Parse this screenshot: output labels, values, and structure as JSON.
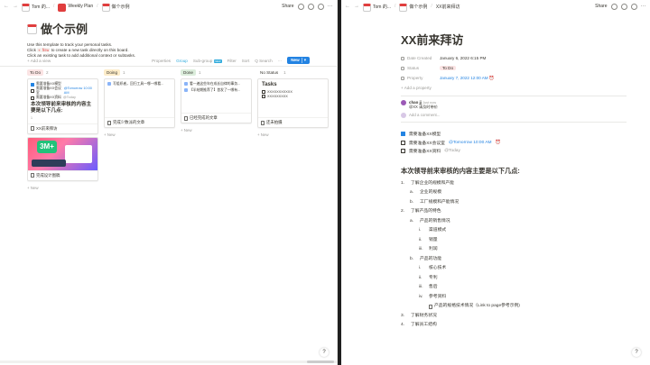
{
  "left": {
    "topbar": {
      "back": "←",
      "forward": "→",
      "crumbs": [
        "Tom 的...",
        "Weekly Plan",
        "做个示例"
      ],
      "share": "Share",
      "more": "···"
    },
    "page": {
      "title": "做个示例",
      "desc1": "Use this template to track your personal tasks.",
      "desc2_pre": "Click",
      "desc2_code": "+ New",
      "desc2_post": "to create a new task directly on this board.",
      "desc3": "Click an existing task to add additional context or subtasks."
    },
    "viewbar": {
      "add_view": "+ Add a view",
      "properties": "Properties",
      "group": "Group",
      "subgroup": "Sub-group",
      "subgroup_badge": "NEW",
      "filter": "Filter",
      "sort": "Sort",
      "search": "Q Search",
      "more": "···",
      "new": "New",
      "new_caret": "▾"
    },
    "columns": [
      {
        "label": "To Do",
        "count": "2"
      },
      {
        "label": "Doing",
        "count": "1"
      },
      {
        "label": "Done",
        "count": "1"
      },
      {
        "label": "No Status",
        "count": "1"
      }
    ],
    "todo_card1": {
      "chk1": "需要准备XX模型",
      "chk2a": "需要准备XX会议室 ",
      "chk2b": "@Tomorrow 10:00 AM",
      "chk3a": "需要准备XX资料 ",
      "chk3b": "@Today",
      "heading": "本次领导前来审核的内容主要是以下几点:",
      "tag": "1",
      "title": "XX前来拜访"
    },
    "todo_card2": {
      "title": "完成设计图稿"
    },
    "doing_card": {
      "cover": "写组织者，回归工具一哪一哪看...",
      "title": "完成少数派的文章"
    },
    "done_card": {
      "cover1": "看一遍这些年在成长自律的事务...",
      "cover2": "【半结期推荐了】首发了一哪有...",
      "title": "已经完成的文章"
    },
    "nostatus_card": {
      "heading": "Tasks",
      "item1": "XXXXXXXXXXX",
      "item2": "XXXXXXXXX",
      "title": "还未拍摄"
    },
    "new_label": "+ New",
    "help": "?"
  },
  "right": {
    "topbar": {
      "back": "←",
      "forward": "→",
      "crumbs": [
        "Tom 的...",
        "做个示例",
        "XX前来拜访"
      ],
      "share": "Share",
      "more": "···"
    },
    "title": "XX前来拜访",
    "props": [
      {
        "key": "Date Created",
        "value": "January 6, 2022 6:15 PM"
      },
      {
        "key": "Status",
        "value": "To Do"
      },
      {
        "key": "Property",
        "value": "January 7, 2022 12:00 AM"
      }
    ],
    "add_property": "+ Add a property",
    "comment": {
      "name": "chao jj",
      "time": "Just now",
      "body": "@XX 请及时带价"
    },
    "add_comment": "Add a comment...",
    "checks": [
      {
        "text": "需要准备XX模型",
        "checked": true
      },
      {
        "text": "需要准备XX会议室 ",
        "date": "@Tomorrow 10:00 AM",
        "checked": false
      },
      {
        "text": "需要准备XX资料 ",
        "date": "@Today",
        "checked": false
      }
    ],
    "heading": "本次领导前来审核的内容主要是以下几点:",
    "outline": {
      "i1": "了解企业的规模和产能",
      "i1a": "企业的规模",
      "i1b": "工厂规模和产能情况",
      "i2": "了解产品的特色",
      "i2a": "产品的销售情况",
      "i2a1": "渠道模式",
      "i2a2": "销量",
      "i2a3": "利润",
      "i2b": "产品的功能",
      "i2b1": "核心技术",
      "i2b2": "专利",
      "i2b3": "售后",
      "i2b4": "参考资料",
      "i2b5": "产品的规格技术情况（Link to page参考示例)",
      "i3": "了解财务状况",
      "i4": "了解员工结构"
    },
    "help": "?"
  }
}
